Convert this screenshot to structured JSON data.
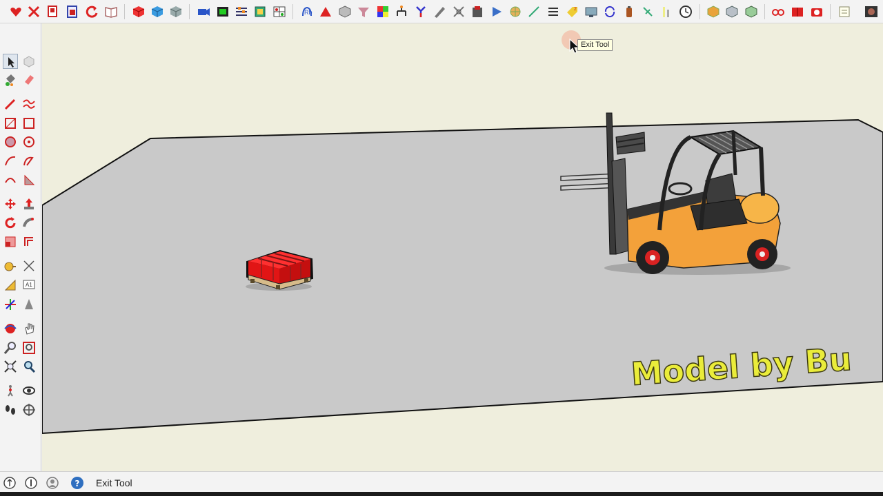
{
  "tooltip": {
    "text": "Exit Tool"
  },
  "status_bar": {
    "text": "Exit Tool",
    "icons": [
      "geo-location-icon",
      "credits-icon",
      "user-account-icon",
      "help-icon"
    ]
  },
  "scene": {
    "watermark": "Model by Bu",
    "objects": [
      "red-pallet-crate-model",
      "forklift-model",
      "ground-plane"
    ]
  },
  "colors": {
    "sky": "#efeedd",
    "ground": "#c9c9c9",
    "crate": "#e02020",
    "forklift_body": "#f4a93a",
    "watermark": "#eaec3a",
    "toolbar": "#f3f3f3"
  },
  "top_toolbar": {
    "buttons": [
      "heart-icon",
      "cut-icon",
      "copy-icon",
      "paste-icon",
      "undo-icon",
      "open-book-icon",
      "red-cube-icon",
      "blue-cube-icon",
      "gray-cube-icon",
      "camera-icon",
      "film-icon",
      "sliders-icon",
      "layers-icon",
      "grid-icon",
      "paint-icon",
      "triangle-icon",
      "box-icon",
      "funnel-icon",
      "color-cube-icon",
      "hierarchy-icon",
      "arrow-split-icon",
      "pencil-icon",
      "select-icon",
      "cube-stack-icon",
      "arrow-icon",
      "globe-icon",
      "line-icon",
      "list-icon",
      "tag-icon",
      "monitor-icon",
      "refresh-icon",
      "bottle-icon",
      "plug-icon",
      "bar-icon",
      "clock-icon",
      "orange-box-icon",
      "gray-box-icon",
      "green-box-icon",
      "red-glasses-icon",
      "red-book-icon",
      "red-camera-icon",
      "note-icon",
      "camera-square-icon"
    ]
  },
  "left_toolbar": {
    "tools": [
      "select-tool-icon",
      "component-icon",
      "paint-bucket-icon",
      "eraser-icon",
      "line-tool-icon",
      "freehand-icon",
      "rectangle-icon",
      "rotated-rectangle-icon",
      "circle-icon",
      "polygon-icon",
      "arc-icon",
      "two-point-arc-icon",
      "three-point-arc-icon",
      "pie-icon",
      "move-icon",
      "push-pull-icon",
      "rotate-icon",
      "follow-me-icon",
      "scale-icon",
      "offset-icon",
      "tape-measure-icon",
      "dimension-icon",
      "protractor-icon",
      "text-icon",
      "axes-icon",
      "3d-text-icon",
      "orbit-icon",
      "pan-icon",
      "zoom-icon",
      "zoom-window-icon",
      "zoom-extents-icon",
      "previous-view-icon",
      "position-camera-icon",
      "look-around-icon",
      "walk-icon",
      "section-plane-icon"
    ]
  }
}
